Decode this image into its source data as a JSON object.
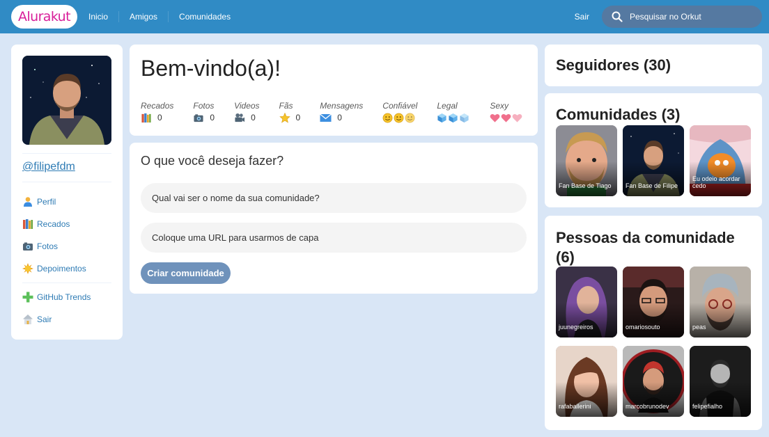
{
  "header": {
    "logo": "Alurakut",
    "nav": [
      "Inicio",
      "Amigos",
      "Comunidades"
    ],
    "logout": "Sair",
    "search_placeholder": "Pesquisar no Orkut"
  },
  "profile": {
    "handle": "@filipefdm",
    "menu": [
      {
        "label": "Perfil",
        "icon": "user-icon"
      },
      {
        "label": "Recados",
        "icon": "book-icon"
      },
      {
        "label": "Fotos",
        "icon": "camera-icon"
      },
      {
        "label": "Depoimentos",
        "icon": "sun-icon"
      },
      {
        "label": "GitHub Trends",
        "icon": "plus-icon"
      },
      {
        "label": "Sair",
        "icon": "house-icon"
      }
    ]
  },
  "welcome": {
    "title": "Bem-vindo(a)!",
    "stats": [
      {
        "label": "Recados",
        "value": "0",
        "icon": "book-icon"
      },
      {
        "label": "Fotos",
        "value": "0",
        "icon": "camera-icon"
      },
      {
        "label": "Videos",
        "value": "0",
        "icon": "video-camera-icon"
      },
      {
        "label": "Fãs",
        "value": "0",
        "icon": "star-icon"
      },
      {
        "label": "Mensagens",
        "value": "0",
        "icon": "envelope-icon"
      },
      {
        "label": "Confiável",
        "icon": "smiley-icon",
        "level": 3
      },
      {
        "label": "Legal",
        "icon": "ice-cube-icon",
        "level": 3
      },
      {
        "label": "Sexy",
        "icon": "heart-icon",
        "level": 3
      }
    ]
  },
  "create": {
    "title": "O que você deseja fazer?",
    "name_placeholder": "Qual vai ser o nome da sua comunidade?",
    "url_placeholder": "Coloque uma URL para usarmos de capa",
    "button": "Criar comunidade"
  },
  "followers": {
    "title": "Seguidores (30)"
  },
  "communities": {
    "title": "Comunidades (3)",
    "items": [
      "Fan Base de Tiago",
      "Fan Base de Filipe",
      "Eu odeio acordar cedo"
    ]
  },
  "people": {
    "title": "Pessoas da comunidade (6)",
    "items": [
      "juunegreiros",
      "omariosouto",
      "peas",
      "rafaballerini",
      "marcobrunodev",
      "felipefialho"
    ]
  },
  "colors": {
    "header": "#308BC5",
    "logo": "#D81D99",
    "link": "#2E7BB4",
    "background": "#D9E6F6",
    "button": "#6F92BB"
  }
}
